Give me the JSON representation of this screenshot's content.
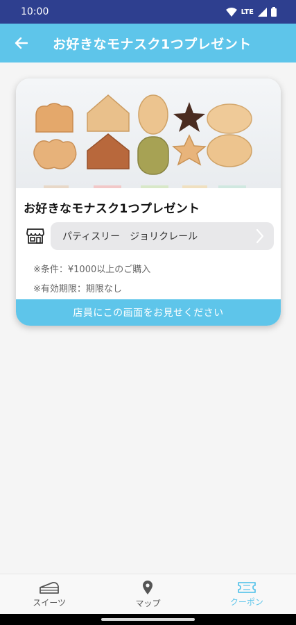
{
  "status_bar": {
    "time": "10:00",
    "network": "LTE",
    "icons": [
      "wifi-icon",
      "signal-icon",
      "battery-icon"
    ]
  },
  "app_bar": {
    "title": "お好きなモナスク1つプレゼント",
    "back_icon": "arrow-left-icon"
  },
  "coupon": {
    "title": "お好きなモナスク1つプレゼント",
    "shop_name": "パティスリー　ジョリクレール",
    "conditions": [
      "※条件：¥1000以上のご購入",
      "※有効期限：期限なし"
    ],
    "footer_text": "店員にこの画面をお見せください"
  },
  "bottom_nav": {
    "items": [
      {
        "label": "スイーツ",
        "icon": "cake-icon",
        "active": false
      },
      {
        "label": "マップ",
        "icon": "map-pin-icon",
        "active": false
      },
      {
        "label": "クーポン",
        "icon": "ticket-icon",
        "active": true
      }
    ]
  },
  "colors": {
    "status_bar": "#2e3f8f",
    "primary": "#5ec5ea",
    "background": "#f5f5f5"
  }
}
